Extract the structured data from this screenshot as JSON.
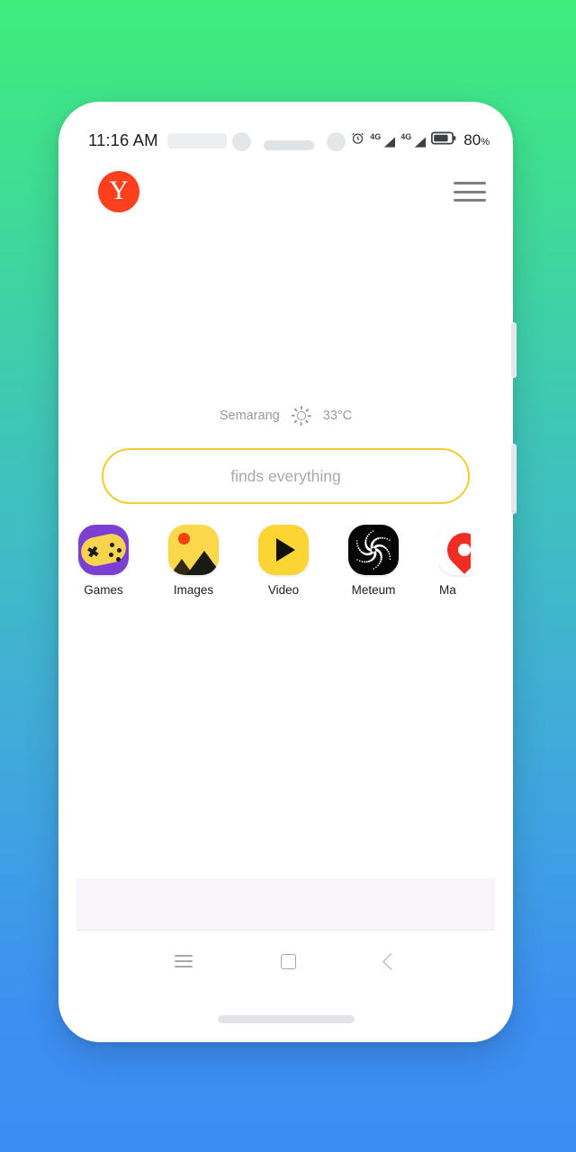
{
  "background": {
    "gradient_top": "#3ded7b",
    "gradient_bottom": "#3b8df4"
  },
  "device": {
    "frame_color": "#ffffff",
    "side_buttons": [
      "volume-rocker",
      "power-button"
    ]
  },
  "status_bar": {
    "time": "11:16 AM",
    "icons": [
      "alarm-icon",
      "signal-4g-sim1",
      "signal-4g-sim2",
      "battery-icon"
    ],
    "network_label": "4G",
    "network_label_secondary": "4G",
    "battery_percent": "80",
    "battery_percent_symbol": "%"
  },
  "app_header": {
    "logo_letter": "Y",
    "logo_color": "#fc3f1d",
    "menu_icon": "hamburger-menu-icon"
  },
  "weather": {
    "city": "Semarang",
    "condition_icon": "sunny-icon",
    "temperature": "33°C"
  },
  "search": {
    "placeholder": "finds everything",
    "border_color": "#f2cd2b"
  },
  "services": [
    {
      "label": "Games",
      "icon": "games-icon",
      "bg": "#7b3fd4"
    },
    {
      "label": "Images",
      "icon": "images-icon",
      "bg": "#fbd74a"
    },
    {
      "label": "Video",
      "icon": "video-icon",
      "bg": "#fcd535"
    },
    {
      "label": "Meteum",
      "icon": "meteum-icon",
      "bg": "#050505"
    },
    {
      "label": "Ma",
      "icon": "maps-icon",
      "bg": "#ffffff"
    }
  ],
  "nav_bar": {
    "recent_label": "recent-apps",
    "home_label": "home",
    "back_label": "back"
  }
}
